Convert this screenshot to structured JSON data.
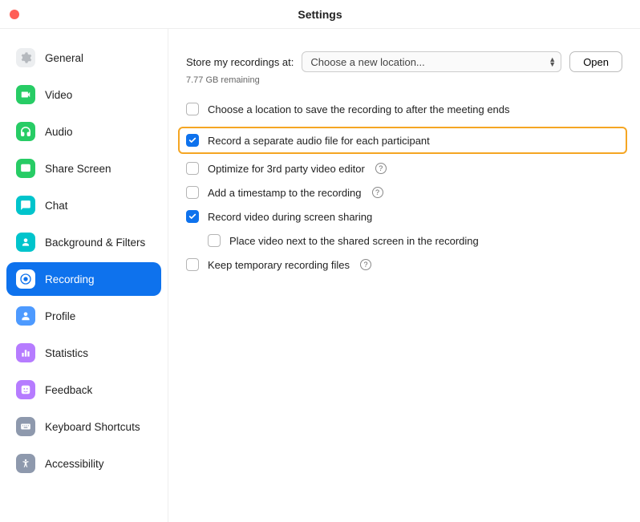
{
  "window": {
    "title": "Settings"
  },
  "sidebar": {
    "items": [
      {
        "label": "General",
        "icon": "gear-icon",
        "bg": "#eceef0",
        "fg": "#b5b9be"
      },
      {
        "label": "Video",
        "icon": "video-icon",
        "bg": "#27cc65",
        "fg": "#fff"
      },
      {
        "label": "Audio",
        "icon": "headphones-icon",
        "bg": "#27cc65",
        "fg": "#fff"
      },
      {
        "label": "Share Screen",
        "icon": "share-screen-icon",
        "bg": "#27cc65",
        "fg": "#fff"
      },
      {
        "label": "Chat",
        "icon": "chat-icon",
        "bg": "#00c4cc",
        "fg": "#fff"
      },
      {
        "label": "Background & Filters",
        "icon": "background-icon",
        "bg": "#00c4cc",
        "fg": "#fff"
      },
      {
        "label": "Recording",
        "icon": "recording-icon",
        "bg": "#fff",
        "fg": "#0e72ed",
        "active": true
      },
      {
        "label": "Profile",
        "icon": "profile-icon",
        "bg": "#4d9aff",
        "fg": "#fff"
      },
      {
        "label": "Statistics",
        "icon": "statistics-icon",
        "bg": "#b67cff",
        "fg": "#fff"
      },
      {
        "label": "Feedback",
        "icon": "feedback-icon",
        "bg": "#b67cff",
        "fg": "#fff"
      },
      {
        "label": "Keyboard Shortcuts",
        "icon": "keyboard-icon",
        "bg": "#8e99ad",
        "fg": "#fff"
      },
      {
        "label": "Accessibility",
        "icon": "accessibility-icon",
        "bg": "#8e99ad",
        "fg": "#fff"
      }
    ]
  },
  "main": {
    "storage_label": "Store my recordings at:",
    "dropdown_value": "Choose a new location...",
    "open_button": "Open",
    "remaining": "7.77 GB remaining",
    "options": [
      {
        "label": "Choose a location to save the recording to after the meeting ends",
        "checked": false,
        "help": false,
        "highlighted": false,
        "indented": false
      },
      {
        "label": "Record a separate audio file for each participant",
        "checked": true,
        "help": false,
        "highlighted": true,
        "indented": false
      },
      {
        "label": "Optimize for 3rd party video editor",
        "checked": false,
        "help": true,
        "highlighted": false,
        "indented": false
      },
      {
        "label": "Add a timestamp to the recording",
        "checked": false,
        "help": true,
        "highlighted": false,
        "indented": false
      },
      {
        "label": "Record video during screen sharing",
        "checked": true,
        "help": false,
        "highlighted": false,
        "indented": false
      },
      {
        "label": "Place video next to the shared screen in the recording",
        "checked": false,
        "help": false,
        "highlighted": false,
        "indented": true
      },
      {
        "label": "Keep temporary recording files",
        "checked": false,
        "help": true,
        "highlighted": false,
        "indented": false
      }
    ]
  }
}
